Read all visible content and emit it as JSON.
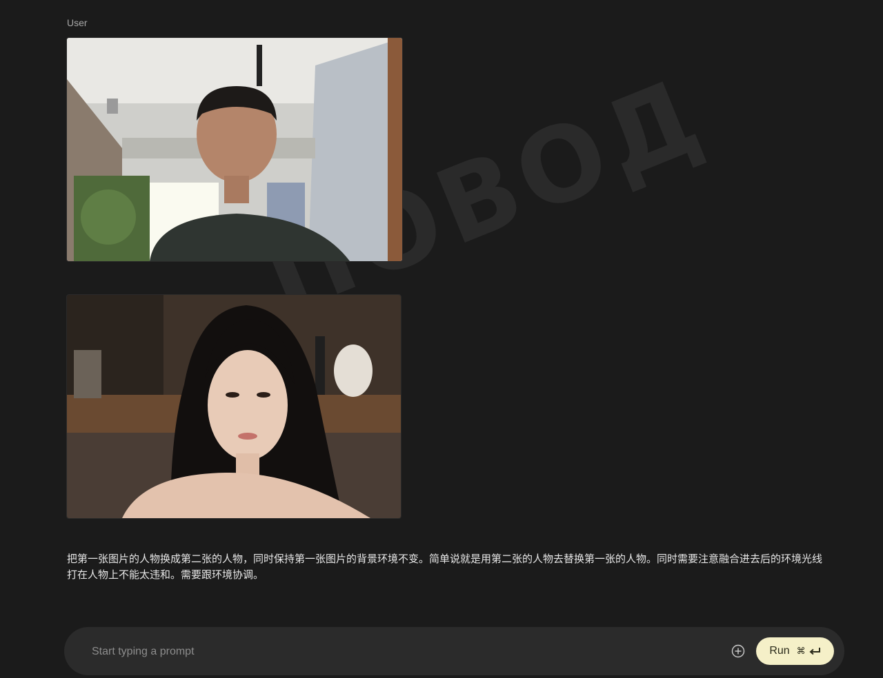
{
  "turn": {
    "role_label": "User",
    "prompt_text": "把第一张图片的人物换成第二张的人物，同时保持第一张图片的背景环境不变。简单说就是用第二张的人物去替换第一张的人物。同时需要注意融合进去后的环境光线打在人物上不能太违和。需要跟环境协调。"
  },
  "watermark": "ПОВОД",
  "composer": {
    "placeholder": "Start typing a prompt",
    "run_label": "Run",
    "run_shortcut": "⌘"
  },
  "icons": {
    "add": "plus-circle-icon",
    "enter": "enter-icon"
  },
  "colors": {
    "background": "#1b1b1b",
    "composer_bg": "#2b2b2b",
    "run_bg": "#f5f0c8"
  }
}
